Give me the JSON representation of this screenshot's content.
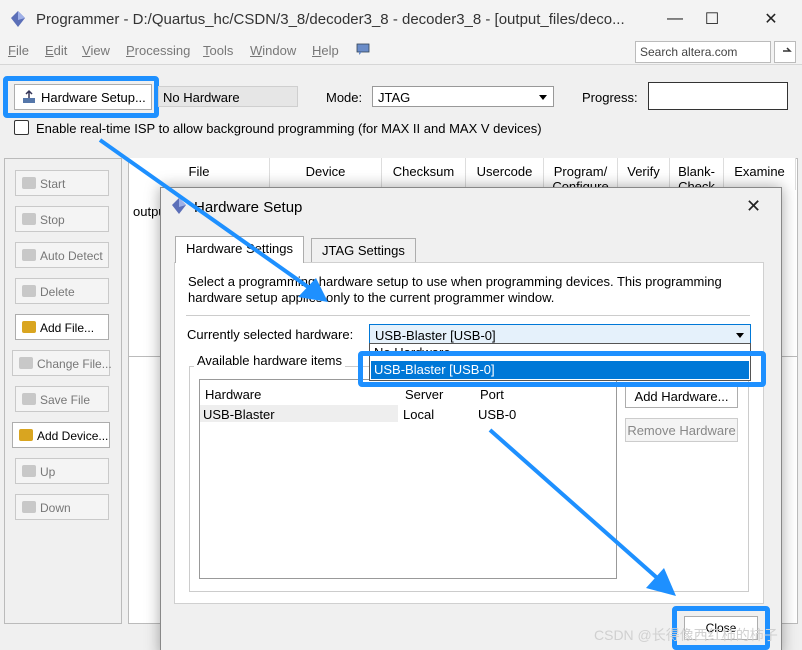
{
  "window": {
    "title": "Programmer - D:/Quartus_hc/CSDN/3_8/decoder3_8 - decoder3_8 - [output_files/deco...",
    "minimize": "—",
    "maximize": "☐",
    "close": "✕"
  },
  "menu": [
    "File",
    "Edit",
    "View",
    "Processing",
    "Tools",
    "Window",
    "Help"
  ],
  "search": {
    "placeholder": "Search altera.com"
  },
  "toolbar": {
    "hardware_setup_label": "Hardware Setup...",
    "hardware_value": "No Hardware",
    "mode_label": "Mode:",
    "mode_value": "JTAG",
    "progress_label": "Progress:",
    "isp_label": "Enable real-time ISP to allow background programming (for MAX II and MAX V devices)"
  },
  "side_buttons": [
    {
      "label": "Start",
      "enabled": false,
      "icon": "start-icon"
    },
    {
      "label": "Stop",
      "enabled": false,
      "icon": "stop-icon"
    },
    {
      "label": "Auto Detect",
      "enabled": false,
      "icon": "auto-detect-icon"
    },
    {
      "label": "Delete",
      "enabled": false,
      "icon": "delete-icon"
    },
    {
      "label": "Add File...",
      "enabled": true,
      "icon": "add-file-icon"
    },
    {
      "label": "Change File...",
      "enabled": false,
      "icon": "change-file-icon"
    },
    {
      "label": "Save File",
      "enabled": false,
      "icon": "save-file-icon"
    },
    {
      "label": "Add Device...",
      "enabled": true,
      "icon": "add-device-icon"
    },
    {
      "label": "Up",
      "enabled": false,
      "icon": "up-icon"
    },
    {
      "label": "Down",
      "enabled": false,
      "icon": "down-icon"
    }
  ],
  "table": {
    "columns": [
      "File",
      "Device",
      "Checksum",
      "Usercode",
      "Program/ Configure",
      "Verify",
      "Blank- Check",
      "Examine"
    ],
    "row_partial": "outpu"
  },
  "dialog": {
    "title": "Hardware Setup",
    "close": "✕",
    "tabs": [
      "Hardware Settings",
      "JTAG Settings"
    ],
    "description": "Select a programming hardware setup to use when programming devices. This programming hardware setup applies only to the current programmer window.",
    "current_label": "Currently selected hardware:",
    "current_value": "USB-Blaster [USB-0]",
    "dropdown_options": [
      "No Hardware",
      "USB-Blaster [USB-0]"
    ],
    "available_label": "Available hardware items",
    "list_columns": [
      "Hardware",
      "Server",
      "Port"
    ],
    "list_rows": [
      {
        "hardware": "USB-Blaster",
        "server": "Local",
        "port": "USB-0"
      }
    ],
    "add_hardware": "Add Hardware...",
    "remove_hardware": "Remove Hardware",
    "close_button": "Close"
  },
  "watermark": "CSDN @长得像西红柿的柿子",
  "colors": {
    "highlight": "#1e90ff",
    "selection": "#0078d7"
  }
}
